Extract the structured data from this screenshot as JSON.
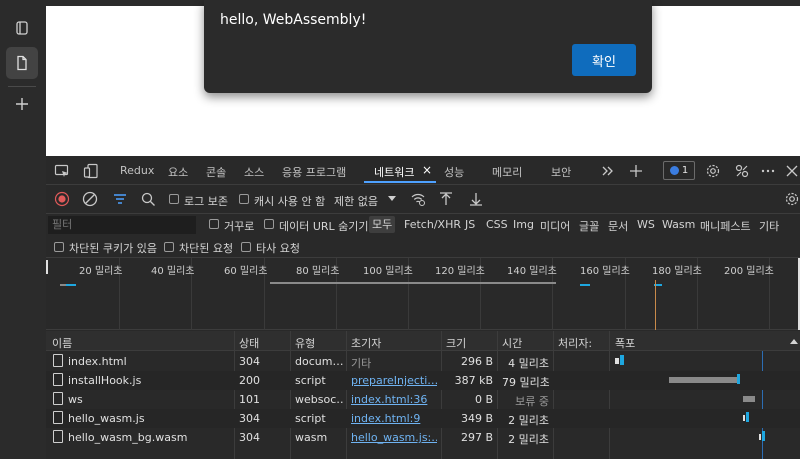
{
  "dialog": {
    "message": "hello, WebAssembly!",
    "ok_label": "확인"
  },
  "tabs": [
    {
      "label": "Redux"
    },
    {
      "label": "요소"
    },
    {
      "label": "콘솔"
    },
    {
      "label": "소스"
    },
    {
      "label": "응용 프로그램"
    },
    {
      "label": "네트워크"
    },
    {
      "label": "성능"
    },
    {
      "label": "메모리"
    },
    {
      "label": "보안"
    }
  ],
  "active_tab_close": "×",
  "badge_count": "1",
  "toolbar": {
    "preserve_log": "로그 보존",
    "disable_cache": "캐시 사용 안 함",
    "throttle": "제한 없음"
  },
  "filter": {
    "placeholder": "필터",
    "invert": "거꾸로",
    "hide_data_urls": "데이터 URL 숨기기",
    "types": [
      "모두",
      "Fetch/XHR",
      "JS",
      "CSS",
      "Img",
      "미디어",
      "글꼴",
      "문서",
      "WS",
      "Wasm",
      "매니페스트",
      "기타"
    ],
    "blocked_cookies": "차단된 쿠키가 있음",
    "blocked_requests": "차단된 요청",
    "third_party": "타사 요청"
  },
  "overview_ticks": [
    "20 밀리초",
    "40 밀리초",
    "60 밀리초",
    "80 밀리초",
    "100 밀리초",
    "120 밀리초",
    "140 밀리초",
    "160 밀리초",
    "180 밀리초",
    "200 밀리초"
  ],
  "columns": {
    "name": "이름",
    "status": "상태",
    "type": "유형",
    "initiator": "초기자",
    "size": "크기",
    "time": "시간",
    "handler": "처리자:",
    "waterfall": "폭포"
  },
  "requests": [
    {
      "name": "index.html",
      "status": "304",
      "type": "docum…",
      "initiator": "기타",
      "initiator_link": false,
      "size": "296 B",
      "time": "4 밀리초"
    },
    {
      "name": "installHook.js",
      "status": "200",
      "type": "script",
      "initiator": "prepareInjecti…",
      "initiator_link": true,
      "size": "387 kB",
      "time": "79 밀리초"
    },
    {
      "name": "ws",
      "status": "101",
      "type": "websoc…",
      "initiator": "index.html:36",
      "initiator_link": true,
      "size": "0 B",
      "time": "보류 중"
    },
    {
      "name": "hello_wasm.js",
      "status": "304",
      "type": "script",
      "initiator": "index.html:9",
      "initiator_link": true,
      "size": "349 B",
      "time": "2 밀리초"
    },
    {
      "name": "hello_wasm_bg.wasm",
      "status": "304",
      "type": "wasm",
      "initiator": "hello_wasm.js:…",
      "initiator_link": true,
      "size": "297 B",
      "time": "2 밀리초"
    }
  ],
  "colors": {
    "accent": "#0f6cbd",
    "link": "#6fb3f2",
    "waterfall_bar": "#1ea7e0",
    "waterfall_queue": "#8a8a8a"
  }
}
